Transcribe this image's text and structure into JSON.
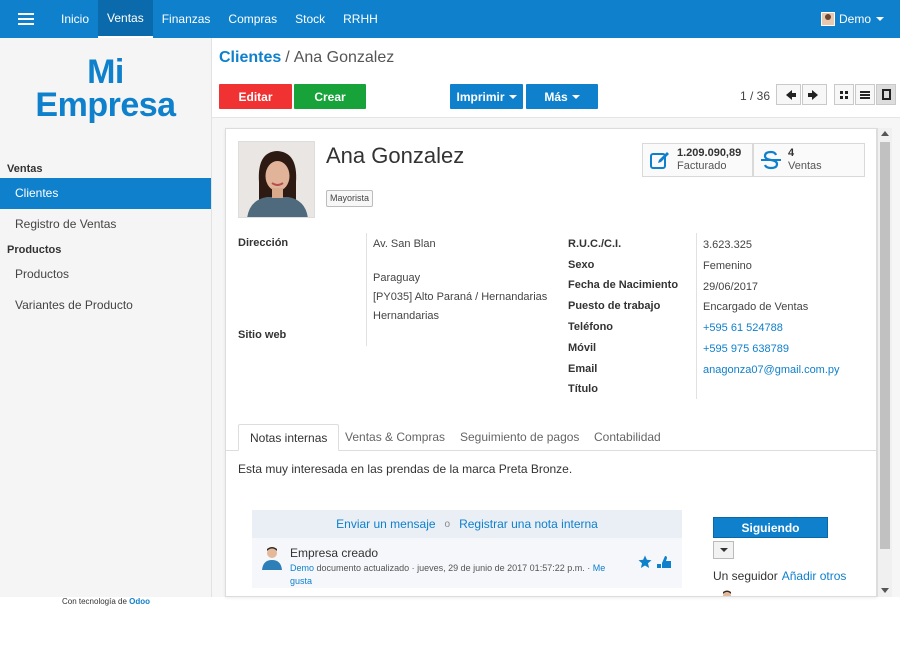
{
  "topbar": {
    "menu": [
      {
        "label": "Inicio",
        "active": false
      },
      {
        "label": "Ventas",
        "active": true
      },
      {
        "label": "Finanzas",
        "active": false
      },
      {
        "label": "Compras",
        "active": false
      },
      {
        "label": "Stock",
        "active": false
      },
      {
        "label": "RRHH",
        "active": false
      }
    ],
    "user": "Demo"
  },
  "sidebar": {
    "logo_line1": "Mi",
    "logo_line2": "Empresa",
    "sections": [
      {
        "title": "Ventas",
        "items": [
          {
            "label": "Clientes",
            "active": true
          },
          {
            "label": "Registro de Ventas",
            "active": false
          }
        ]
      },
      {
        "title": "Productos",
        "items": [
          {
            "label": "Productos",
            "active": false
          },
          {
            "label": "Variantes de Producto",
            "active": false
          }
        ]
      }
    ],
    "powered_prefix": "Con tecnología de",
    "powered_brand": "Odoo"
  },
  "breadcrumb": {
    "parent": "Clientes",
    "separator": "/",
    "current": "Ana Gonzalez"
  },
  "toolbar": {
    "edit_label": "Editar",
    "create_label": "Crear",
    "print_label": "Imprimir",
    "more_label": "Más",
    "pager": "1 / 36"
  },
  "record": {
    "name": "Ana Gonzalez",
    "tag": "Mayorista",
    "stats": [
      {
        "value": "1.209.090,89",
        "label": "Facturado",
        "icon": "pencil-square-icon"
      },
      {
        "value": "4",
        "label": "Ventas",
        "icon": "dollar-strike-icon"
      }
    ],
    "left_fields": {
      "direccion_label": "Dirección",
      "address_street": "Av. San Blan",
      "address_country": "Paraguay",
      "address_state": "[PY035] Alto Paraná / Hernandarias",
      "address_city": "Hernandarias",
      "website_label": "Sitio web"
    },
    "right_fields": [
      {
        "label": "R.U.C./C.I.",
        "value": "3.623.325",
        "link": false
      },
      {
        "label": "Sexo",
        "value": "Femenino",
        "link": false
      },
      {
        "label": "Fecha de Nacimiento",
        "value": "29/06/2017",
        "link": false
      },
      {
        "label": "Puesto de trabajo",
        "value": "Encargado de Ventas",
        "link": false
      },
      {
        "label": "Teléfono",
        "value": "+595 61 524788",
        "link": true
      },
      {
        "label": "Móvil",
        "value": "+595 975 638789",
        "link": true
      },
      {
        "label": "Email",
        "value": "anagonza07@gmail.com.py",
        "link": true
      },
      {
        "label": "Título",
        "value": "",
        "link": false
      }
    ]
  },
  "tabs": [
    {
      "label": "Notas internas",
      "active": true
    },
    {
      "label": "Ventas & Compras",
      "active": false
    },
    {
      "label": "Seguimiento de pagos",
      "active": false
    },
    {
      "label": "Contabilidad",
      "active": false
    }
  ],
  "notes": "Esta muy interesada en las prendas de la marca Preta Bronze.",
  "chatter": {
    "send_message": "Enviar un mensaje",
    "or": "o",
    "log_note": "Registrar una nota interna",
    "message": {
      "title": "Empresa creado",
      "author": "Demo",
      "meta": "documento actualizado · jueves, 29 de junio de 2017 01:57:22 p.m. ·",
      "like_text": "Me gusta"
    },
    "follow_label": "Siguiendo",
    "followers_label": "Un seguidor",
    "add_followers": "Añadir otros"
  },
  "colors": {
    "primary": "#0f80cc",
    "danger": "#f03232",
    "success": "#17a33a"
  }
}
